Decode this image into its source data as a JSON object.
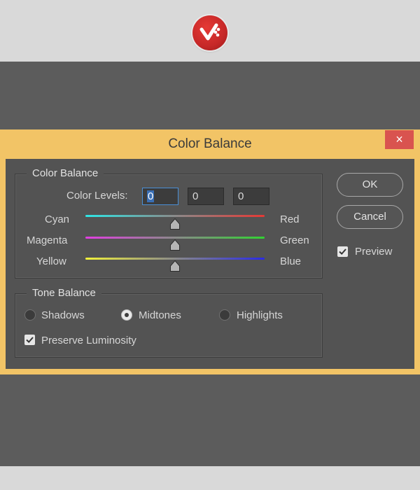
{
  "window": {
    "title": "Color Balance",
    "close_glyph": "×"
  },
  "color_balance": {
    "group_label": "Color Balance",
    "levels_label": "Color Levels:",
    "levels": [
      "0",
      "0",
      "0"
    ],
    "sliders": [
      {
        "left_label": "Cyan",
        "right_label": "Red",
        "value": 0,
        "gradient": [
          "#2ee6e6",
          "#e53935"
        ]
      },
      {
        "left_label": "Magenta",
        "right_label": "Green",
        "value": 0,
        "gradient": [
          "#e23fe2",
          "#32d232"
        ]
      },
      {
        "left_label": "Yellow",
        "right_label": "Blue",
        "value": 0,
        "gradient": [
          "#f2f23a",
          "#2a2ae6"
        ]
      }
    ]
  },
  "tone_balance": {
    "group_label": "Tone Balance",
    "options": [
      {
        "label": "Shadows",
        "selected": false
      },
      {
        "label": "Midtones",
        "selected": true
      },
      {
        "label": "Highlights",
        "selected": false
      }
    ],
    "preserve_luminosity": {
      "label": "Preserve Luminosity",
      "checked": true
    }
  },
  "buttons": {
    "ok": "OK",
    "cancel": "Cancel"
  },
  "preview": {
    "label": "Preview",
    "checked": true
  },
  "colors": {
    "dialog_frame": "#f2c466",
    "dialog_body": "#535353",
    "close_button": "#d9534f",
    "backdrop": "#5c5c5c",
    "logo": "#c62828"
  }
}
